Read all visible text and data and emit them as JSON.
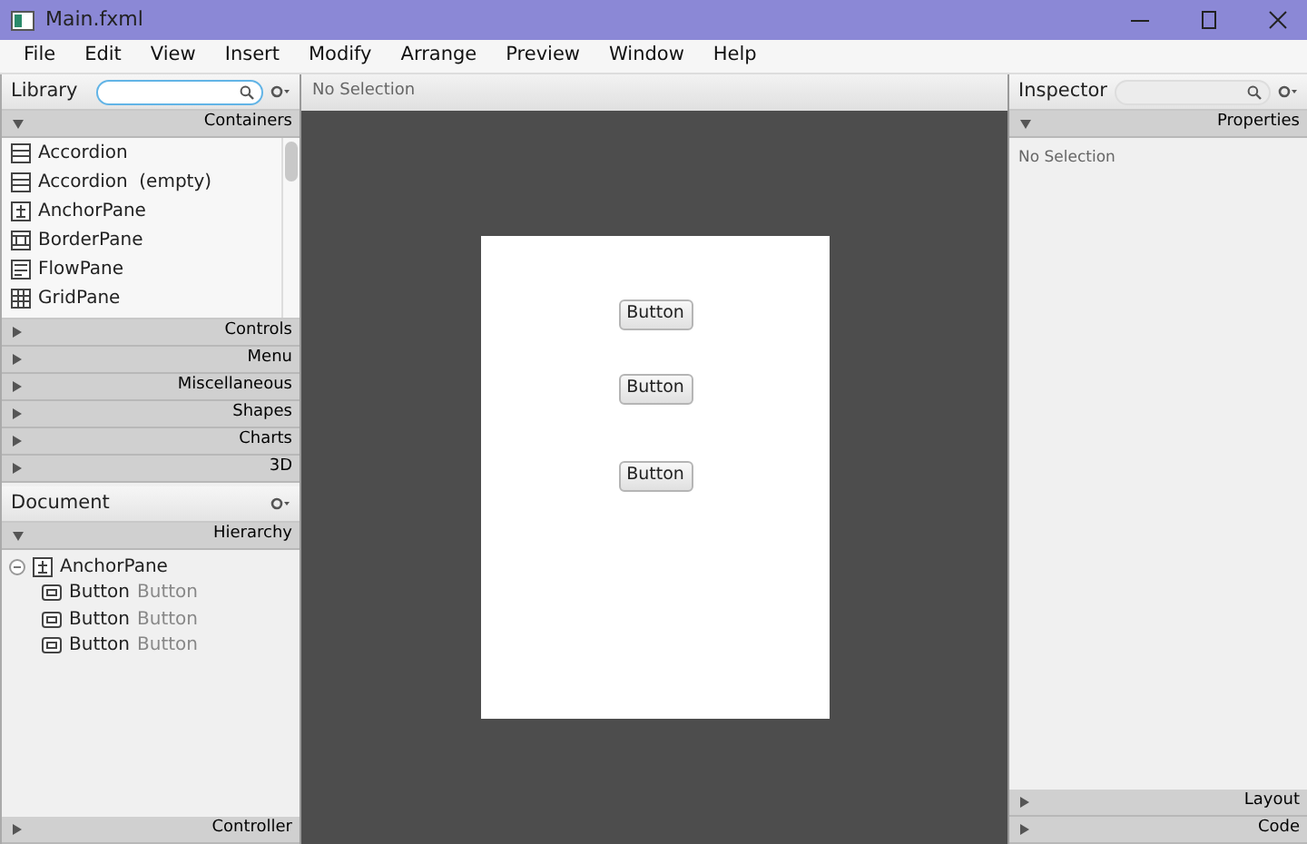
{
  "window": {
    "title": "Main.fxml"
  },
  "menu": [
    "File",
    "Edit",
    "View",
    "Insert",
    "Modify",
    "Arrange",
    "Preview",
    "Window",
    "Help"
  ],
  "library": {
    "title": "Library",
    "sections": [
      {
        "label": "Containers",
        "expanded": true,
        "items": [
          {
            "kind": "accordion",
            "label": "Accordion"
          },
          {
            "kind": "accordion",
            "label": "Accordion  (empty)"
          },
          {
            "kind": "anchor",
            "label": "AnchorPane"
          },
          {
            "kind": "border",
            "label": "BorderPane"
          },
          {
            "kind": "flow",
            "label": "FlowPane"
          },
          {
            "kind": "grid",
            "label": "GridPane"
          }
        ]
      },
      {
        "label": "Controls",
        "expanded": false
      },
      {
        "label": "Menu",
        "expanded": false
      },
      {
        "label": "Miscellaneous",
        "expanded": false
      },
      {
        "label": "Shapes",
        "expanded": false
      },
      {
        "label": "Charts",
        "expanded": false
      },
      {
        "label": "3D",
        "expanded": false
      }
    ]
  },
  "document": {
    "title": "Document",
    "sections": [
      {
        "label": "Hierarchy",
        "expanded": true
      }
    ],
    "tree": [
      {
        "kind": "anchor",
        "type": "AnchorPane",
        "expanded": true,
        "children": [
          {
            "kind": "button",
            "type": "Button",
            "text": "Button"
          },
          {
            "kind": "button",
            "type": "Button",
            "text": "Button"
          },
          {
            "kind": "button",
            "type": "Button",
            "text": "Button"
          }
        ]
      }
    ],
    "footer": {
      "label": "Controller",
      "expanded": false
    }
  },
  "canvas": {
    "status": "No Selection",
    "buttons": [
      "Button",
      "Button",
      "Button"
    ]
  },
  "inspector": {
    "title": "Inspector",
    "sections": [
      {
        "label": "Properties",
        "expanded": true
      }
    ],
    "message": "No Selection",
    "footer": [
      {
        "label": "Layout",
        "expanded": false
      },
      {
        "label": "Code",
        "expanded": false
      }
    ]
  }
}
